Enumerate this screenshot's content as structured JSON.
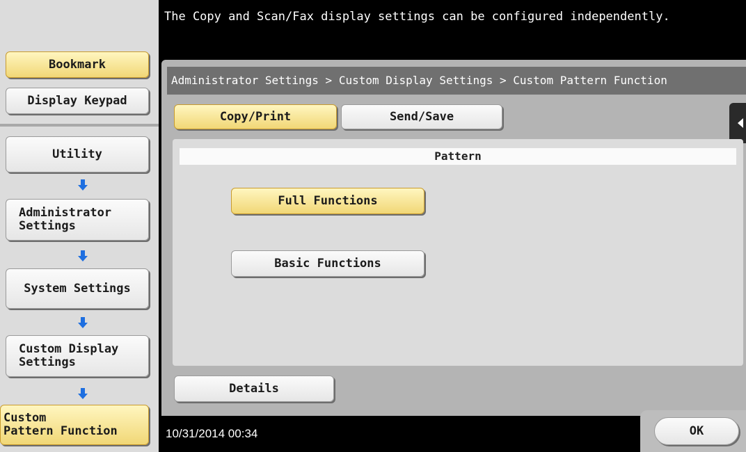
{
  "message": "The Copy and Scan/Fax display settings can be configured independently.",
  "sidebar": {
    "bookmark": "Bookmark",
    "display_keypad": "Display Keypad",
    "nav": [
      "Utility",
      "Administrator\nSettings",
      "System Settings",
      "Custom Display\nSettings",
      "Custom\nPattern Function"
    ]
  },
  "breadcrumb": "Administrator Settings > Custom Display Settings > Custom Pattern Function",
  "tabs": {
    "copy_print": "Copy/Print",
    "send_save": "Send/Save"
  },
  "pattern": {
    "heading": "Pattern",
    "options": [
      "Full Functions",
      "Basic Functions"
    ],
    "selected": "Full Functions"
  },
  "details": "Details",
  "status": {
    "datetime": "10/31/2014  00:34"
  },
  "ok": "OK",
  "colors": {
    "highlight": "#f1d776",
    "breadcrumb_bg": "#707070",
    "panel_bg": "#b4b4b4",
    "arrow": "#1e6fe0"
  },
  "icons": {
    "nav_arrow": "down-arrow-icon",
    "side_tab": "triangle-left-icon"
  }
}
